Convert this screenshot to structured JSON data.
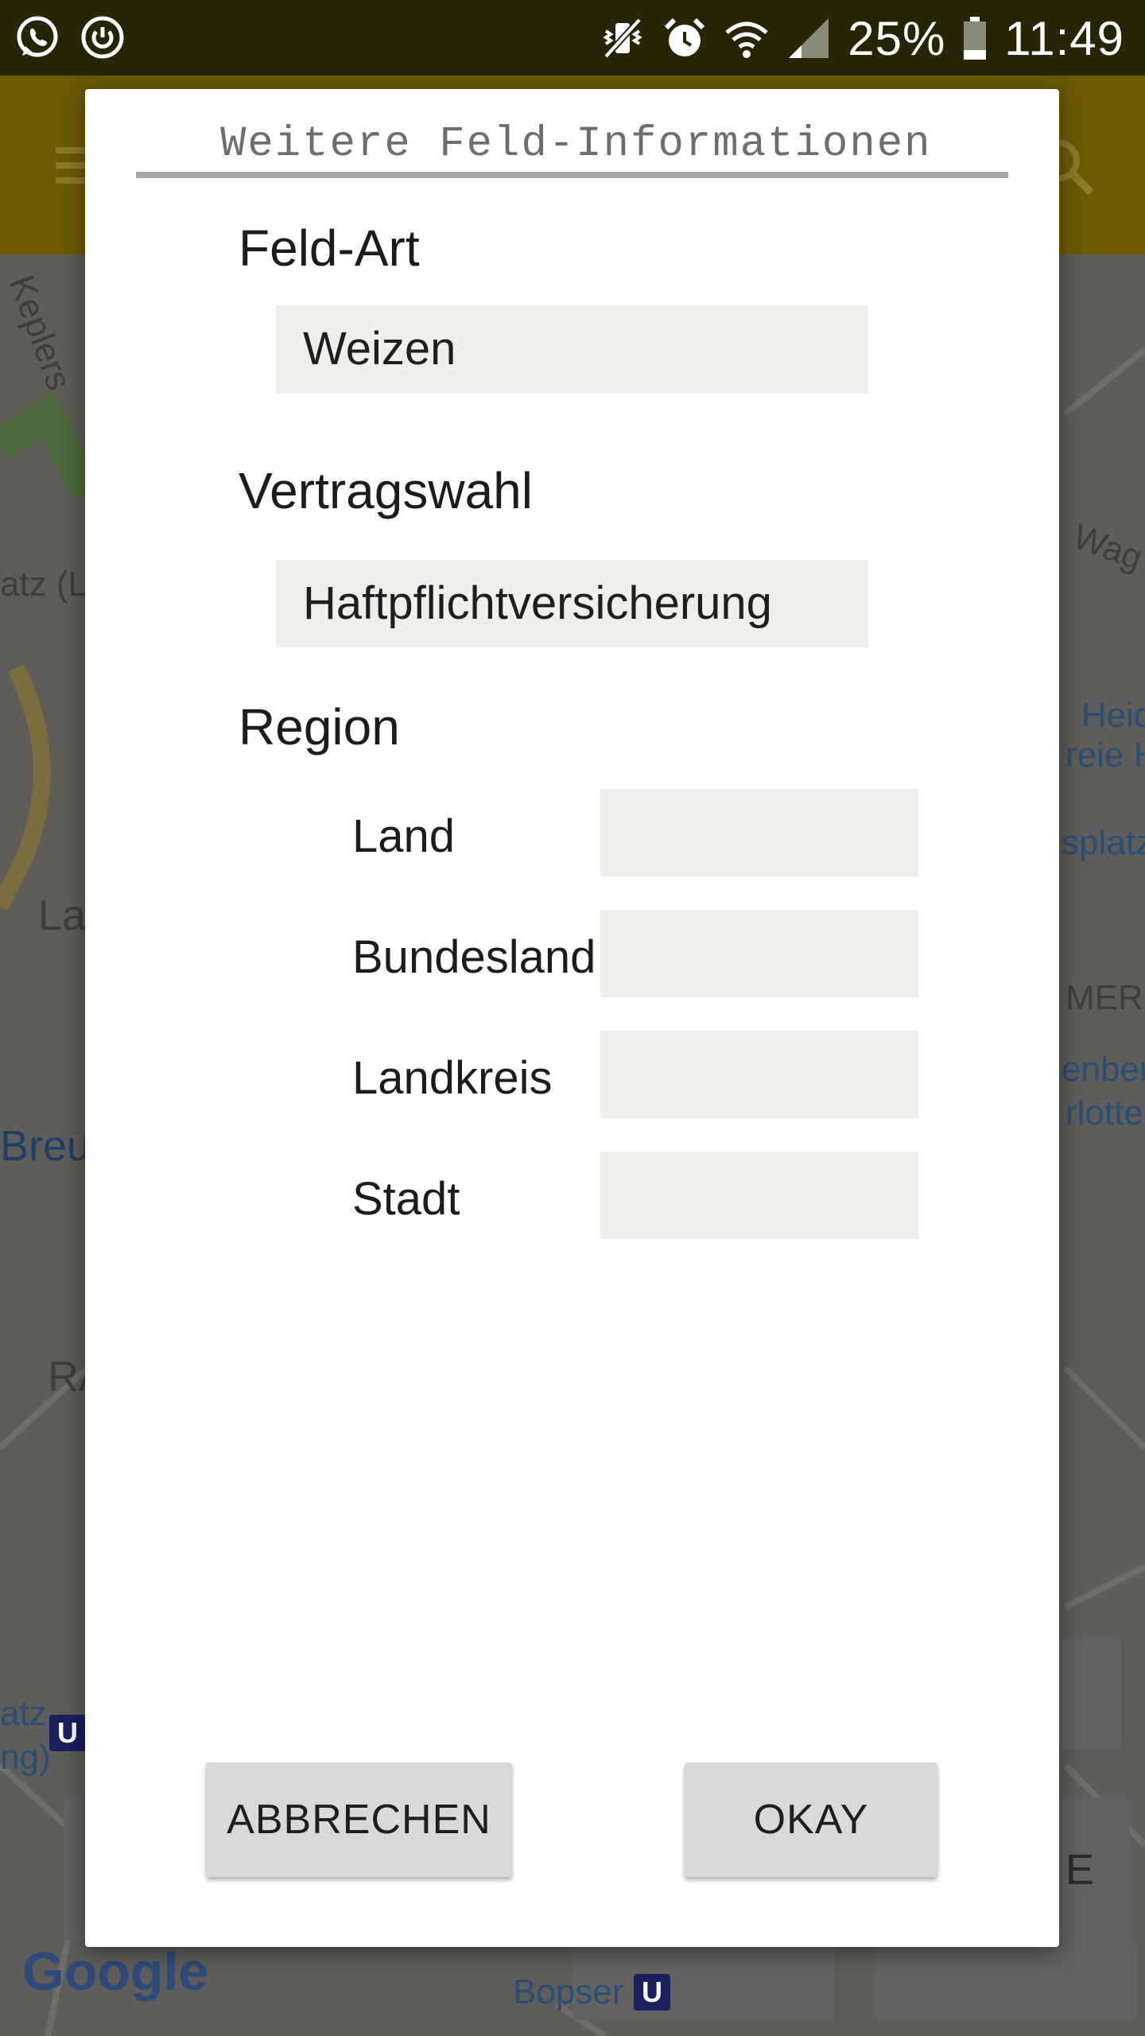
{
  "status_bar": {
    "battery": "25%",
    "time": "11:49",
    "left_icons": [
      "whatsapp-icon",
      "power-icon"
    ],
    "right_icons": [
      "vibrate-icon",
      "alarm-icon",
      "wifi-icon",
      "signal-icon",
      "battery-icon"
    ]
  },
  "map": {
    "labels": [
      "Keplers",
      "atz (L-",
      "La",
      "Breu",
      "RA",
      "atz",
      "ng)",
      "Wag",
      "Heid",
      "reie H",
      "splatz",
      "MERS",
      "enberg",
      "rlotte",
      "E",
      "Bopser"
    ],
    "logo": "Google",
    "transit_badge": "U"
  },
  "dialog": {
    "title": "Weitere Feld-Informationen",
    "field_type": {
      "label": "Feld-Art",
      "value": "Weizen"
    },
    "contract": {
      "label": "Vertragswahl",
      "value": "Haftpflichtversicherung"
    },
    "region": {
      "label": "Region",
      "fields": [
        {
          "label": "Land",
          "value": ""
        },
        {
          "label": "Bundesland",
          "value": ""
        },
        {
          "label": "Landkreis",
          "value": ""
        },
        {
          "label": "Stadt",
          "value": ""
        }
      ]
    },
    "buttons": {
      "cancel": "ABBRECHEN",
      "ok": "OKAY"
    }
  },
  "colors": {
    "status_bar": "#2a2406",
    "app_bar_dimmed": "#6b5b05",
    "field_background": "#eef0ea",
    "button_background": "#d9d9d9",
    "title_rule": "#a6a6a6"
  }
}
